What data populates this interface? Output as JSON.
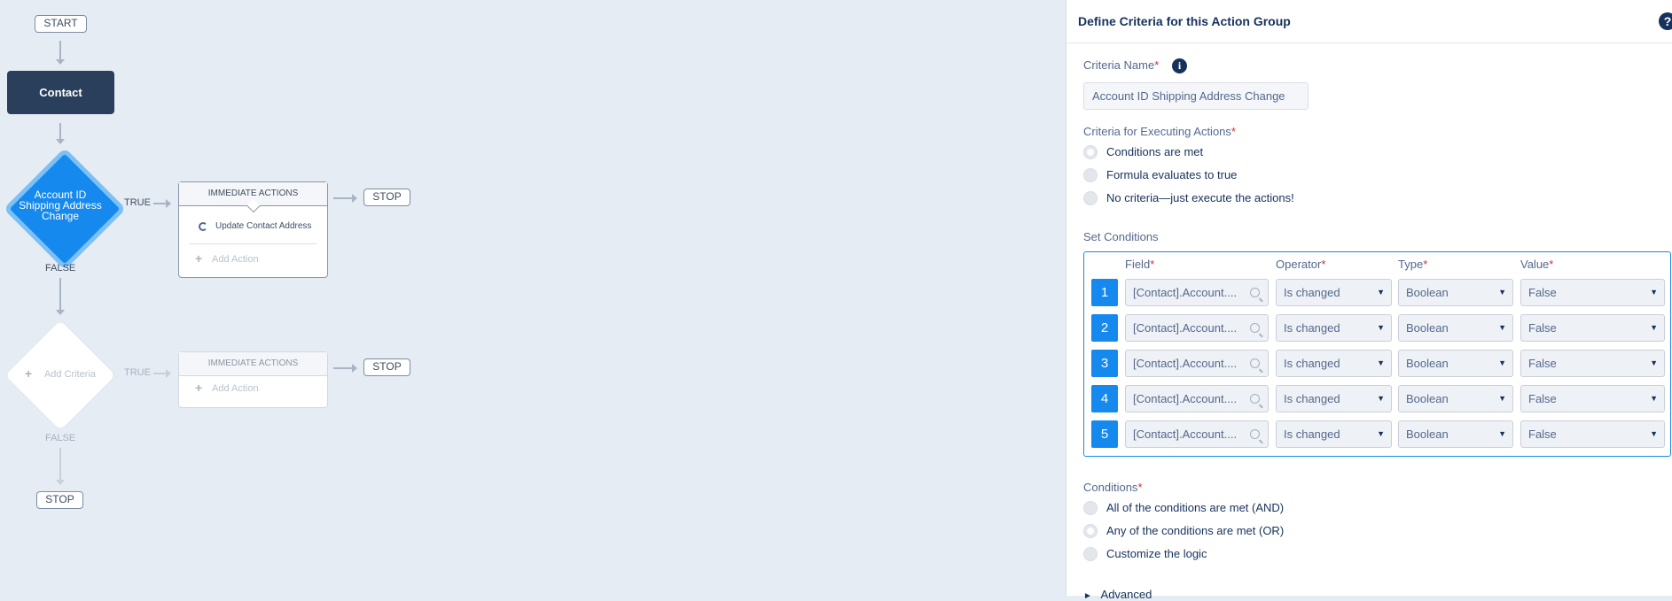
{
  "canvas": {
    "start_label": "START",
    "contact_label": "Contact",
    "criteria_node_label": "Account ID Shipping Address Change",
    "true_label": "TRUE",
    "false_label": "FALSE",
    "immediate_actions_label": "IMMEDIATE ACTIONS",
    "action_item": "Update Contact Address",
    "add_action_label": "Add Action",
    "stop_label": "STOP",
    "add_criteria_label": "Add Criteria"
  },
  "panel": {
    "title": "Define Criteria for this Action Group",
    "criteria_name_label": "Criteria Name",
    "criteria_name_value": "Account ID Shipping Address Change",
    "criteria_exec_label": "Criteria for Executing Actions",
    "exec_options": [
      "Conditions are met",
      "Formula evaluates to true",
      "No criteria—just execute the actions!"
    ],
    "set_conditions_label": "Set Conditions",
    "columns": [
      "Field",
      "Operator",
      "Type",
      "Value"
    ],
    "rows": [
      {
        "num": "1",
        "field": "[Contact].Account....",
        "operator": "Is changed",
        "type": "Boolean",
        "value": "False"
      },
      {
        "num": "2",
        "field": "[Contact].Account....",
        "operator": "Is changed",
        "type": "Boolean",
        "value": "False"
      },
      {
        "num": "3",
        "field": "[Contact].Account....",
        "operator": "Is changed",
        "type": "Boolean",
        "value": "False"
      },
      {
        "num": "4",
        "field": "[Contact].Account....",
        "operator": "Is changed",
        "type": "Boolean",
        "value": "False"
      },
      {
        "num": "5",
        "field": "[Contact].Account....",
        "operator": "Is changed",
        "type": "Boolean",
        "value": "False"
      }
    ],
    "conditions_label": "Conditions",
    "condition_options": [
      "All of the conditions are met (AND)",
      "Any of the conditions are met (OR)",
      "Customize the logic"
    ],
    "advanced_label": "Advanced",
    "required_mark": "*"
  },
  "colors": {
    "accent": "#1589ee",
    "node_dark": "#2a3f5b",
    "canvas_bg": "#e5ecf4"
  }
}
